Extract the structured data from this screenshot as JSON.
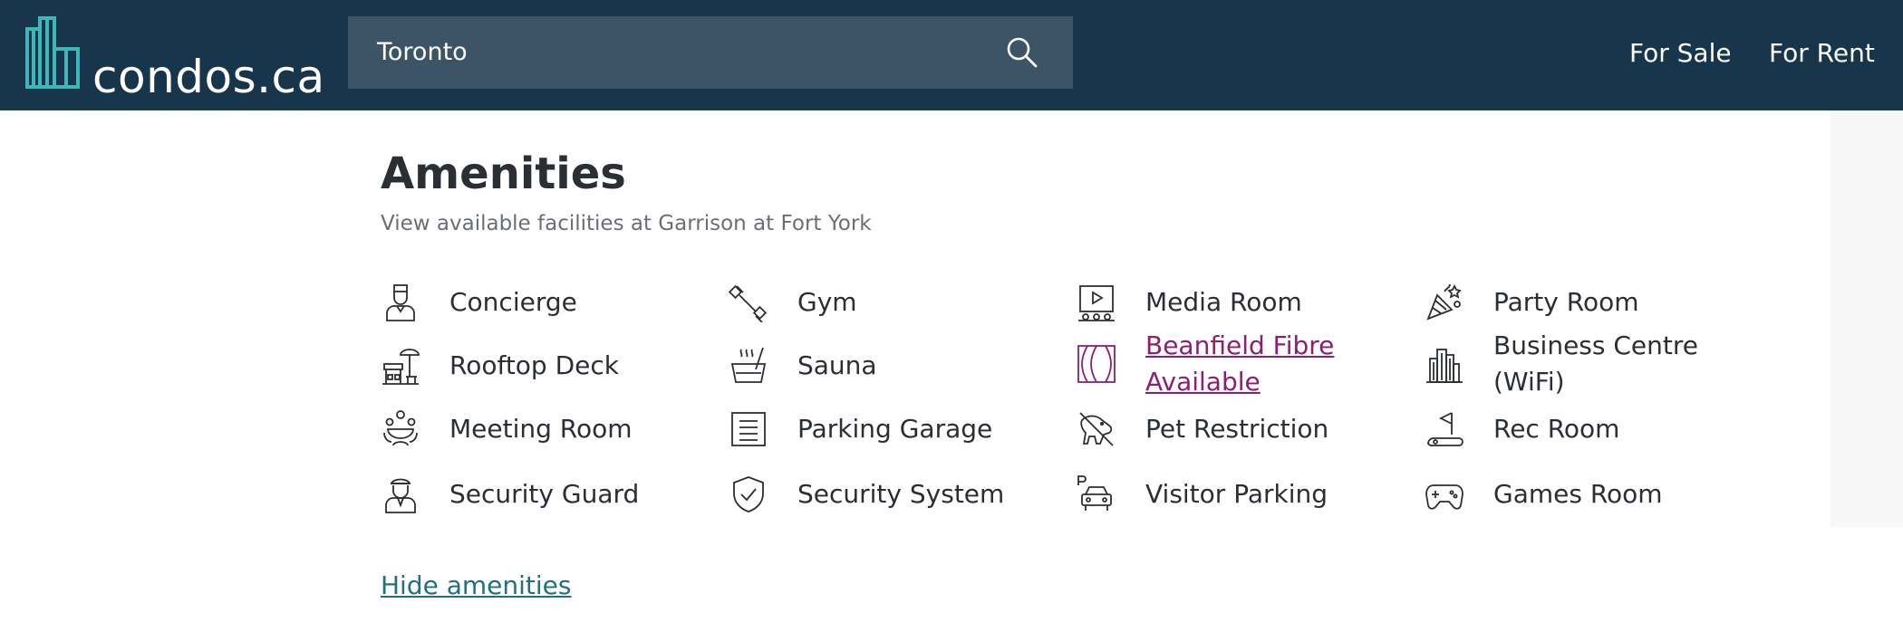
{
  "header": {
    "logo_text": "condos.ca",
    "search_value": "Toronto",
    "nav": [
      "For Sale",
      "For Rent"
    ]
  },
  "section": {
    "title": "Amenities",
    "subtitle": "View available facilities at Garrison at Fort York",
    "hide_label": "Hide amenities"
  },
  "amenities": [
    {
      "label": "Concierge",
      "icon": "concierge-icon"
    },
    {
      "label": "Gym",
      "icon": "dumbbell-icon"
    },
    {
      "label": "Media Room",
      "icon": "media-room-icon"
    },
    {
      "label": "Party Room",
      "icon": "party-icon"
    },
    {
      "label": "Rooftop Deck",
      "icon": "rooftop-deck-icon"
    },
    {
      "label": "Sauna",
      "icon": "sauna-icon"
    },
    {
      "label": "Beanfield Fibre Available",
      "icon": "beanfield-icon"
    },
    {
      "label": "Business Centre (WiFi)",
      "icon": "business-centre-icon"
    },
    {
      "label": "Meeting Room",
      "icon": "meeting-room-icon"
    },
    {
      "label": "Parking Garage",
      "icon": "parking-garage-icon"
    },
    {
      "label": "Pet Restriction",
      "icon": "pet-restriction-icon"
    },
    {
      "label": "Rec Room",
      "icon": "rec-room-icon"
    },
    {
      "label": "Security Guard",
      "icon": "security-guard-icon"
    },
    {
      "label": "Security System",
      "icon": "shield-icon"
    },
    {
      "label": "Visitor Parking",
      "icon": "visitor-parking-icon"
    },
    {
      "label": "Games Room",
      "icon": "gamepad-icon"
    }
  ],
  "colors": {
    "header_bg": "#18364b",
    "search_bg": "#3c5466",
    "logo_accent": "#3fb6b8",
    "link_purple": "#8e1f70",
    "link_teal": "#21707e"
  }
}
